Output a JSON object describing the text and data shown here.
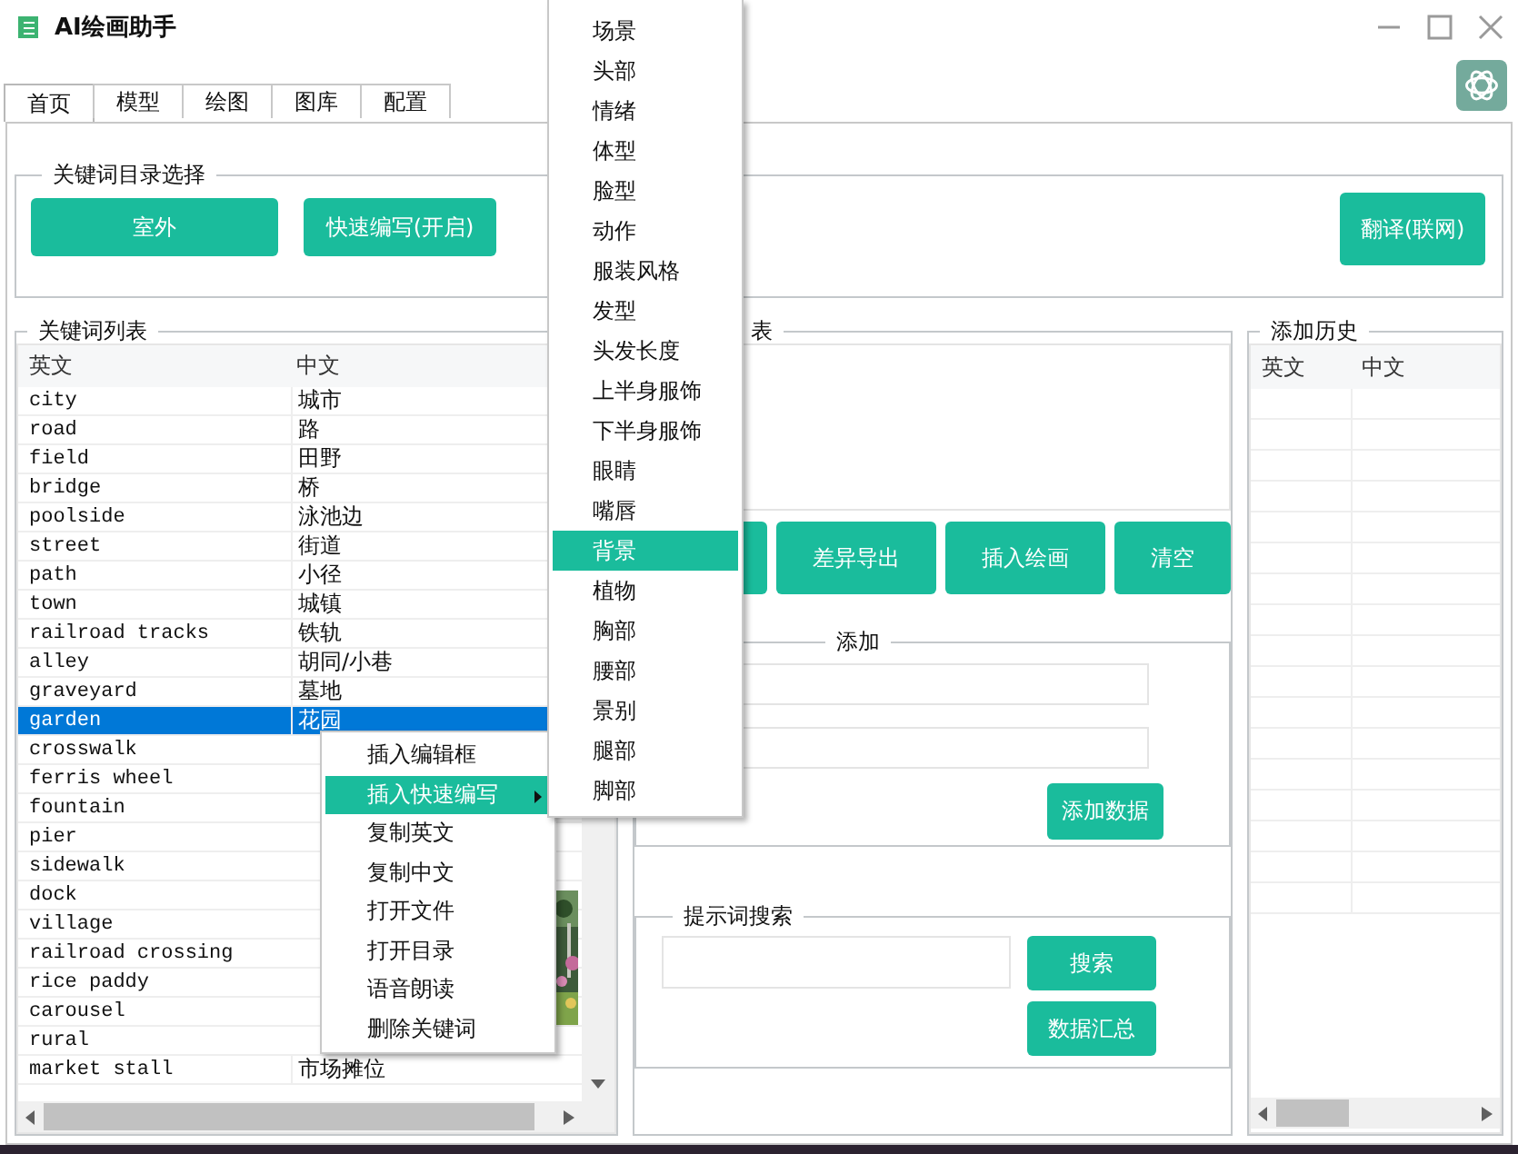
{
  "window": {
    "title": "AI绘画助手"
  },
  "tabs": [
    {
      "label": "首页",
      "selected": true
    },
    {
      "label": "模型",
      "selected": false
    },
    {
      "label": "绘图",
      "selected": false
    },
    {
      "label": "图库",
      "selected": false
    },
    {
      "label": "配置",
      "selected": false
    }
  ],
  "keyword_category": {
    "title": "关键词目录选择",
    "buttons": [
      "室外",
      "快速编写(开启)"
    ],
    "translate_button": "翻译(联网)"
  },
  "keyword_list": {
    "title": "关键词列表",
    "columns": [
      "英文",
      "中文"
    ],
    "rows": [
      {
        "en": "city",
        "zh": "城市",
        "selected": false
      },
      {
        "en": "road",
        "zh": "路",
        "selected": false
      },
      {
        "en": "field",
        "zh": "田野",
        "selected": false
      },
      {
        "en": "bridge",
        "zh": "桥",
        "selected": false
      },
      {
        "en": "poolside",
        "zh": "泳池边",
        "selected": false
      },
      {
        "en": "street",
        "zh": "街道",
        "selected": false
      },
      {
        "en": "path",
        "zh": "小径",
        "selected": false
      },
      {
        "en": "town",
        "zh": "城镇",
        "selected": false
      },
      {
        "en": "railroad tracks",
        "zh": "铁轨",
        "selected": false
      },
      {
        "en": "alley",
        "zh": "胡同/小巷",
        "selected": false
      },
      {
        "en": "graveyard",
        "zh": "墓地",
        "selected": false
      },
      {
        "en": "garden",
        "zh": "花园",
        "selected": true
      },
      {
        "en": "crosswalk",
        "selected": false
      },
      {
        "en": "ferris wheel",
        "selected": false
      },
      {
        "en": "fountain",
        "selected": false
      },
      {
        "en": "pier",
        "selected": false
      },
      {
        "en": "sidewalk",
        "selected": false
      },
      {
        "en": "dock",
        "selected": false
      },
      {
        "en": "village",
        "selected": false
      },
      {
        "en": "railroad crossing",
        "selected": false
      },
      {
        "en": "rice paddy",
        "selected": false
      },
      {
        "en": "carousel",
        "selected": false
      },
      {
        "en": "rural",
        "selected": false
      },
      {
        "en": "market stall",
        "zh": "市场摊位",
        "selected": false
      }
    ]
  },
  "middle": {
    "title": "表",
    "buttons": [
      "差异导出",
      "插入绘画",
      "清空"
    ],
    "add_group": {
      "title": "添加",
      "button": "添加数据"
    },
    "search_group": {
      "title": "提示词搜索",
      "buttons": [
        "搜索",
        "数据汇总"
      ]
    }
  },
  "history": {
    "title": "添加历史",
    "columns": [
      "英文",
      "中文"
    ]
  },
  "context_menu": {
    "items": [
      {
        "label": "插入编辑框",
        "selected": false,
        "has_submenu": false
      },
      {
        "label": "插入快速编写",
        "selected": true,
        "has_submenu": true
      },
      {
        "label": "复制英文",
        "selected": false,
        "has_submenu": false
      },
      {
        "label": "复制中文",
        "selected": false,
        "has_submenu": false
      },
      {
        "label": "打开文件",
        "selected": false,
        "has_submenu": false
      },
      {
        "label": "打开目录",
        "selected": false,
        "has_submenu": false
      },
      {
        "label": "语音朗读",
        "selected": false,
        "has_submenu": false
      },
      {
        "label": "删除关键词",
        "selected": false,
        "has_submenu": false
      }
    ]
  },
  "submenu": {
    "items": [
      {
        "label": "场景",
        "selected": false
      },
      {
        "label": "头部",
        "selected": false
      },
      {
        "label": "情绪",
        "selected": false
      },
      {
        "label": "体型",
        "selected": false
      },
      {
        "label": "脸型",
        "selected": false
      },
      {
        "label": "动作",
        "selected": false
      },
      {
        "label": "服装风格",
        "selected": false
      },
      {
        "label": "发型",
        "selected": false
      },
      {
        "label": "头发长度",
        "selected": false
      },
      {
        "label": "上半身服饰",
        "selected": false
      },
      {
        "label": "下半身服饰",
        "selected": false
      },
      {
        "label": "眼睛",
        "selected": false
      },
      {
        "label": "嘴唇",
        "selected": false
      },
      {
        "label": "背景",
        "selected": true
      },
      {
        "label": "植物",
        "selected": false
      },
      {
        "label": "胸部",
        "selected": false
      },
      {
        "label": "腰部",
        "selected": false
      },
      {
        "label": "景别",
        "selected": false
      },
      {
        "label": "腿部",
        "selected": false
      },
      {
        "label": "脚部",
        "selected": false
      }
    ]
  }
}
